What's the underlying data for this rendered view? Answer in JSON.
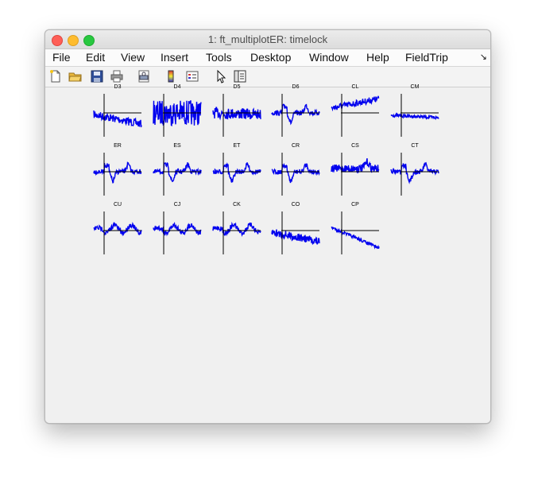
{
  "window": {
    "title": "1: ft_multiplotER: timelock"
  },
  "menu": {
    "items": [
      "File",
      "Edit",
      "View",
      "Insert",
      "Tools",
      "Desktop",
      "Window",
      "Help",
      "FieldTrip"
    ],
    "overflow_icon": "menu-overflow-arrow"
  },
  "toolbar": {
    "icons": [
      "new-figure-icon",
      "open-file-icon",
      "save-icon",
      "print-icon",
      "print-preview-icon",
      "colorbar-icon",
      "legend-icon",
      "pointer-icon",
      "property-editor-icon"
    ]
  },
  "colors": {
    "trace": "#0000ee",
    "axis": "#000000"
  },
  "chart_data": {
    "type": "line",
    "layout": "topographic multiplot",
    "channels": [
      {
        "name": "D3",
        "row": 1,
        "col": 1,
        "shape": "noisy-negative-drift"
      },
      {
        "name": "D4",
        "row": 1,
        "col": 2,
        "shape": "high-noise"
      },
      {
        "name": "D5",
        "row": 1,
        "col": 3,
        "shape": "noisy-flat"
      },
      {
        "name": "D6",
        "row": 1,
        "col": 4,
        "shape": "evoked-deflection"
      },
      {
        "name": "CL",
        "row": 1,
        "col": 5,
        "shape": "positive-drift"
      },
      {
        "name": "CM",
        "row": 1,
        "col": 6,
        "shape": "flat"
      },
      {
        "name": "ER",
        "row": 2,
        "col": 1,
        "shape": "evoked-deflection"
      },
      {
        "name": "ES",
        "row": 2,
        "col": 2,
        "shape": "evoked-deflection"
      },
      {
        "name": "ET",
        "row": 2,
        "col": 3,
        "shape": "evoked-deflection"
      },
      {
        "name": "CR",
        "row": 2,
        "col": 4,
        "shape": "evoked-deflection"
      },
      {
        "name": "CS",
        "row": 2,
        "col": 5,
        "shape": "positive-bump"
      },
      {
        "name": "CT",
        "row": 2,
        "col": 6,
        "shape": "evoked-deflection"
      },
      {
        "name": "CU",
        "row": 3,
        "col": 1,
        "shape": "oscillating"
      },
      {
        "name": "CJ",
        "row": 3,
        "col": 2,
        "shape": "oscillating"
      },
      {
        "name": "CK",
        "row": 3,
        "col": 3,
        "shape": "oscillating"
      },
      {
        "name": "CO",
        "row": 3,
        "col": 4,
        "shape": "noisy-negative-drift"
      },
      {
        "name": "CP",
        "row": 3,
        "col": 5,
        "shape": "negative-drift"
      }
    ]
  }
}
